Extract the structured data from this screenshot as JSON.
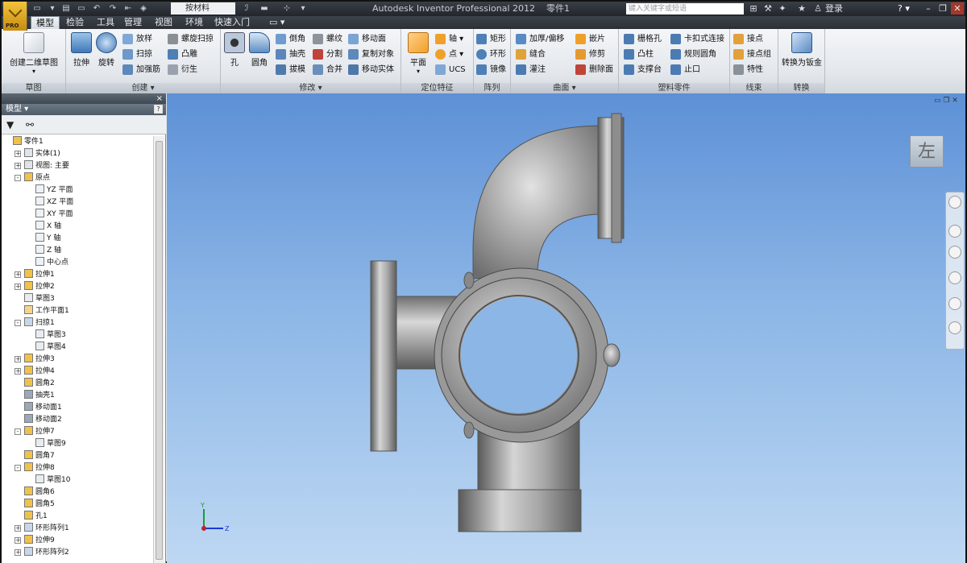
{
  "titlebar": {
    "app_title": "Autodesk Inventor Professional 2012",
    "doc_name": "零件1",
    "material": "按材料",
    "search_placeholder": "键入关键字或短语",
    "login": "登录",
    "help": "?",
    "logo_badge": "PRO"
  },
  "tabs": [
    "模型",
    "检验",
    "工具",
    "管理",
    "视图",
    "环境",
    "快速入门"
  ],
  "ribbon": {
    "sketch": {
      "title": "草图",
      "create_2d": "创建二维草图"
    },
    "create": {
      "title": "创建 ▾",
      "extrude": "拉伸",
      "revolve": "旋转",
      "loft": "放样",
      "sweep": "扫掠",
      "rib": "加强筋",
      "coil": "螺旋扫掠",
      "emboss": "凸雕",
      "derive": "衍生"
    },
    "modify": {
      "title": "修改 ▾",
      "hole": "孔",
      "fillet": "圆角",
      "chamfer": "倒角",
      "shell": "抽壳",
      "draft": "拔模",
      "thread": "螺纹",
      "split": "分割",
      "combine": "合并",
      "move_face": "移动面",
      "copy_object": "复制对象",
      "move_body": "移动实体"
    },
    "work": {
      "title": "定位特征",
      "plane": "平面",
      "axis": "轴",
      "point": "点",
      "ucs": "UCS"
    },
    "pattern": {
      "title": "阵列",
      "rect": "矩形",
      "circ": "环形",
      "mirror": "镜像"
    },
    "surface": {
      "title": "曲面 ▾",
      "thicken": "加厚/偏移",
      "stitch": "缝合",
      "patch": "灌注",
      "sculpt": "嵌片",
      "trim": "修剪",
      "delete_face": "删除面"
    },
    "plastic": {
      "title": "塑料零件",
      "grill": "栅格孔",
      "boss": "凸柱",
      "rest": "支撑台",
      "snap": "卡扣式连接",
      "rule_fillet": "规则圆角",
      "lip": "止口"
    },
    "harness": {
      "title": "线束",
      "splice": "接点",
      "splice_group": "接点组",
      "property": "特性"
    },
    "convert": {
      "title": "转换",
      "to_sheet": "转换为钣金"
    }
  },
  "browser": {
    "header": "模型 ▾",
    "close": "×",
    "help": "?",
    "tree": [
      {
        "label": "零件1",
        "level": 0,
        "icon": "part-icon",
        "exp": ""
      },
      {
        "label": "实体(1)",
        "level": 1,
        "icon": "solid-icon",
        "exp": "+"
      },
      {
        "label": "视图: 主要",
        "level": 1,
        "icon": "view-icon",
        "exp": "+"
      },
      {
        "label": "原点",
        "level": 1,
        "icon": "folder-icon",
        "exp": "-"
      },
      {
        "label": "YZ 平面",
        "level": 2,
        "icon": "plane-icon",
        "exp": ""
      },
      {
        "label": "XZ 平面",
        "level": 2,
        "icon": "plane-icon",
        "exp": ""
      },
      {
        "label": "XY 平面",
        "level": 2,
        "icon": "plane-icon",
        "exp": ""
      },
      {
        "label": "X 轴",
        "level": 2,
        "icon": "axis-icon",
        "exp": ""
      },
      {
        "label": "Y 轴",
        "level": 2,
        "icon": "axis-icon",
        "exp": ""
      },
      {
        "label": "Z 轴",
        "level": 2,
        "icon": "axis-icon",
        "exp": ""
      },
      {
        "label": "中心点",
        "level": 2,
        "icon": "point-icon",
        "exp": ""
      },
      {
        "label": "拉伸1",
        "level": 1,
        "icon": "extrude-icon",
        "exp": "+"
      },
      {
        "label": "拉伸2",
        "level": 1,
        "icon": "extrude-icon",
        "exp": "+"
      },
      {
        "label": "草图3",
        "level": 1,
        "icon": "sketch-icon",
        "exp": ""
      },
      {
        "label": "工作平面1",
        "level": 1,
        "icon": "workplane-icon",
        "exp": ""
      },
      {
        "label": "扫掠1",
        "level": 1,
        "icon": "sweep-icon",
        "exp": "-"
      },
      {
        "label": "草图3",
        "level": 2,
        "icon": "sketch-icon",
        "exp": ""
      },
      {
        "label": "草图4",
        "level": 2,
        "icon": "sketch-icon",
        "exp": ""
      },
      {
        "label": "拉伸3",
        "level": 1,
        "icon": "extrude-icon",
        "exp": "+"
      },
      {
        "label": "拉伸4",
        "level": 1,
        "icon": "extrude-icon",
        "exp": "+"
      },
      {
        "label": "圆角2",
        "level": 1,
        "icon": "fillet-icon",
        "exp": ""
      },
      {
        "label": "抽壳1",
        "level": 1,
        "icon": "shell-icon",
        "exp": ""
      },
      {
        "label": "移动面1",
        "level": 1,
        "icon": "moveface-icon",
        "exp": ""
      },
      {
        "label": "移动面2",
        "level": 1,
        "icon": "moveface-icon",
        "exp": ""
      },
      {
        "label": "拉伸7",
        "level": 1,
        "icon": "extrude-icon",
        "exp": "-"
      },
      {
        "label": "草图9",
        "level": 2,
        "icon": "sketch-icon",
        "exp": ""
      },
      {
        "label": "圆角7",
        "level": 1,
        "icon": "fillet-icon",
        "exp": ""
      },
      {
        "label": "拉伸8",
        "level": 1,
        "icon": "extrude-icon",
        "exp": "-"
      },
      {
        "label": "草图10",
        "level": 2,
        "icon": "sketch-icon",
        "exp": ""
      },
      {
        "label": "圆角6",
        "level": 1,
        "icon": "fillet-icon",
        "exp": ""
      },
      {
        "label": "圆角5",
        "level": 1,
        "icon": "fillet-icon",
        "exp": ""
      },
      {
        "label": "孔1",
        "level": 1,
        "icon": "hole-icon",
        "exp": ""
      },
      {
        "label": "环形阵列1",
        "level": 1,
        "icon": "pattern-icon",
        "exp": "+"
      },
      {
        "label": "拉伸9",
        "level": 1,
        "icon": "extrude-icon",
        "exp": "+"
      },
      {
        "label": "环形阵列2",
        "level": 1,
        "icon": "pattern-icon",
        "exp": "+"
      }
    ]
  },
  "viewport": {
    "viewcube_label": "左",
    "triad_y": "Y",
    "triad_z": "Z"
  },
  "colors": {
    "accent": "#f0a02a",
    "viewport_top": "#5d90d6",
    "viewport_bottom": "#bed8f3"
  }
}
